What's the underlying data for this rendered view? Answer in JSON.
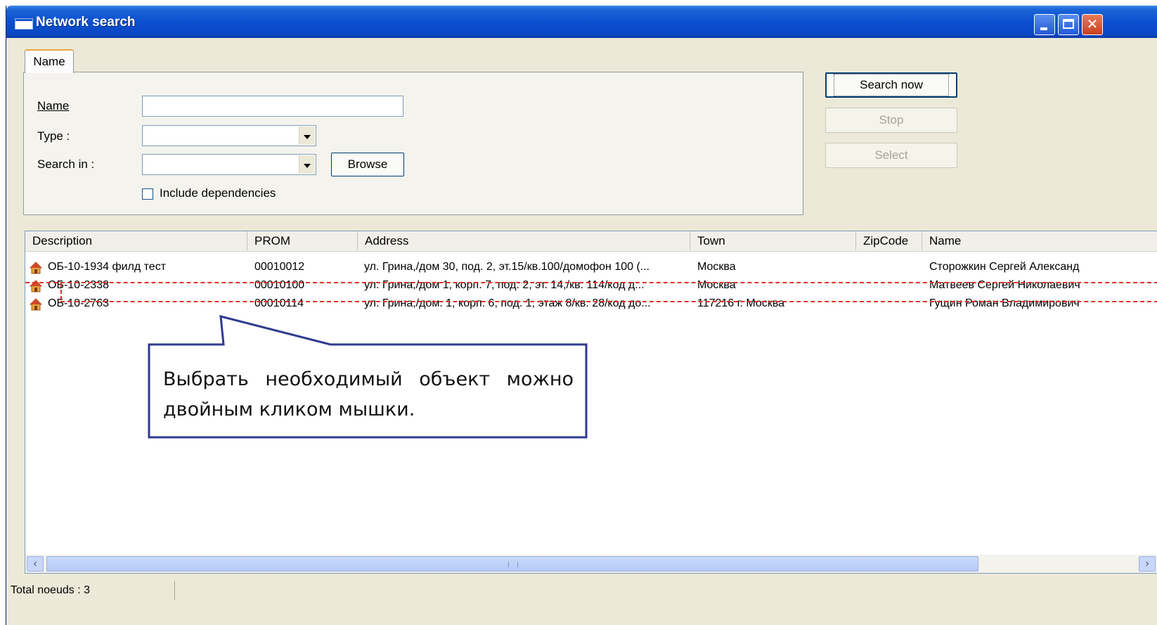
{
  "window": {
    "title": "Network search",
    "controls": [
      "minimize",
      "maximize",
      "close"
    ]
  },
  "tab": {
    "label": "Name"
  },
  "form": {
    "name_label": "Name",
    "type_label": "Type :",
    "search_in_label": "Search in :",
    "browse_label": "Browse",
    "include_dependencies_label": "Include dependencies"
  },
  "actions": {
    "search_now": "Search now",
    "stop": "Stop",
    "select": "Select"
  },
  "table": {
    "columns": [
      "Description",
      "PROM",
      "Address",
      "Town",
      "ZipCode",
      "Name"
    ],
    "rows": [
      {
        "description": "ОБ-10-1934 филд тест",
        "prom": "00010012",
        "address": "ул. Грина,/дом 30, под. 2, эт.15/кв.100/домофон 100 (...",
        "town": "Москва",
        "zipcode": "",
        "name": "Сторожкин Сергей Александ"
      },
      {
        "description": "ОБ-10-2338",
        "prom": "00010100",
        "address": "ул. Грина,/дом 1, корп. 7, под. 2, эт. 14,/кв. 114/код д...",
        "town": "Москва",
        "zipcode": "",
        "name": "Матвеев Сергей Николаевич"
      },
      {
        "description": "ОБ-10-2763",
        "prom": "00010114",
        "address": "ул. Грина,/дом. 1, корп. 6, под. 1, этаж 8/кв. 28/код до...",
        "town": "117216 г. Москва",
        "zipcode": "",
        "name": "Гущин Роман Владимирович"
      }
    ]
  },
  "status": {
    "total": "Total noeuds : 3"
  },
  "callout": {
    "text": "Выбрать необходимый объект можно двойным кликом мышки."
  },
  "colors": {
    "titlebar": "#0b4fd0",
    "annotation_dash": "#e0322a",
    "callout_border": "#2f3a8f"
  },
  "icons": [
    "window-app-icon",
    "house-icon",
    "chevron-down-icon",
    "scroll-left-icon",
    "scroll-right-icon"
  ]
}
